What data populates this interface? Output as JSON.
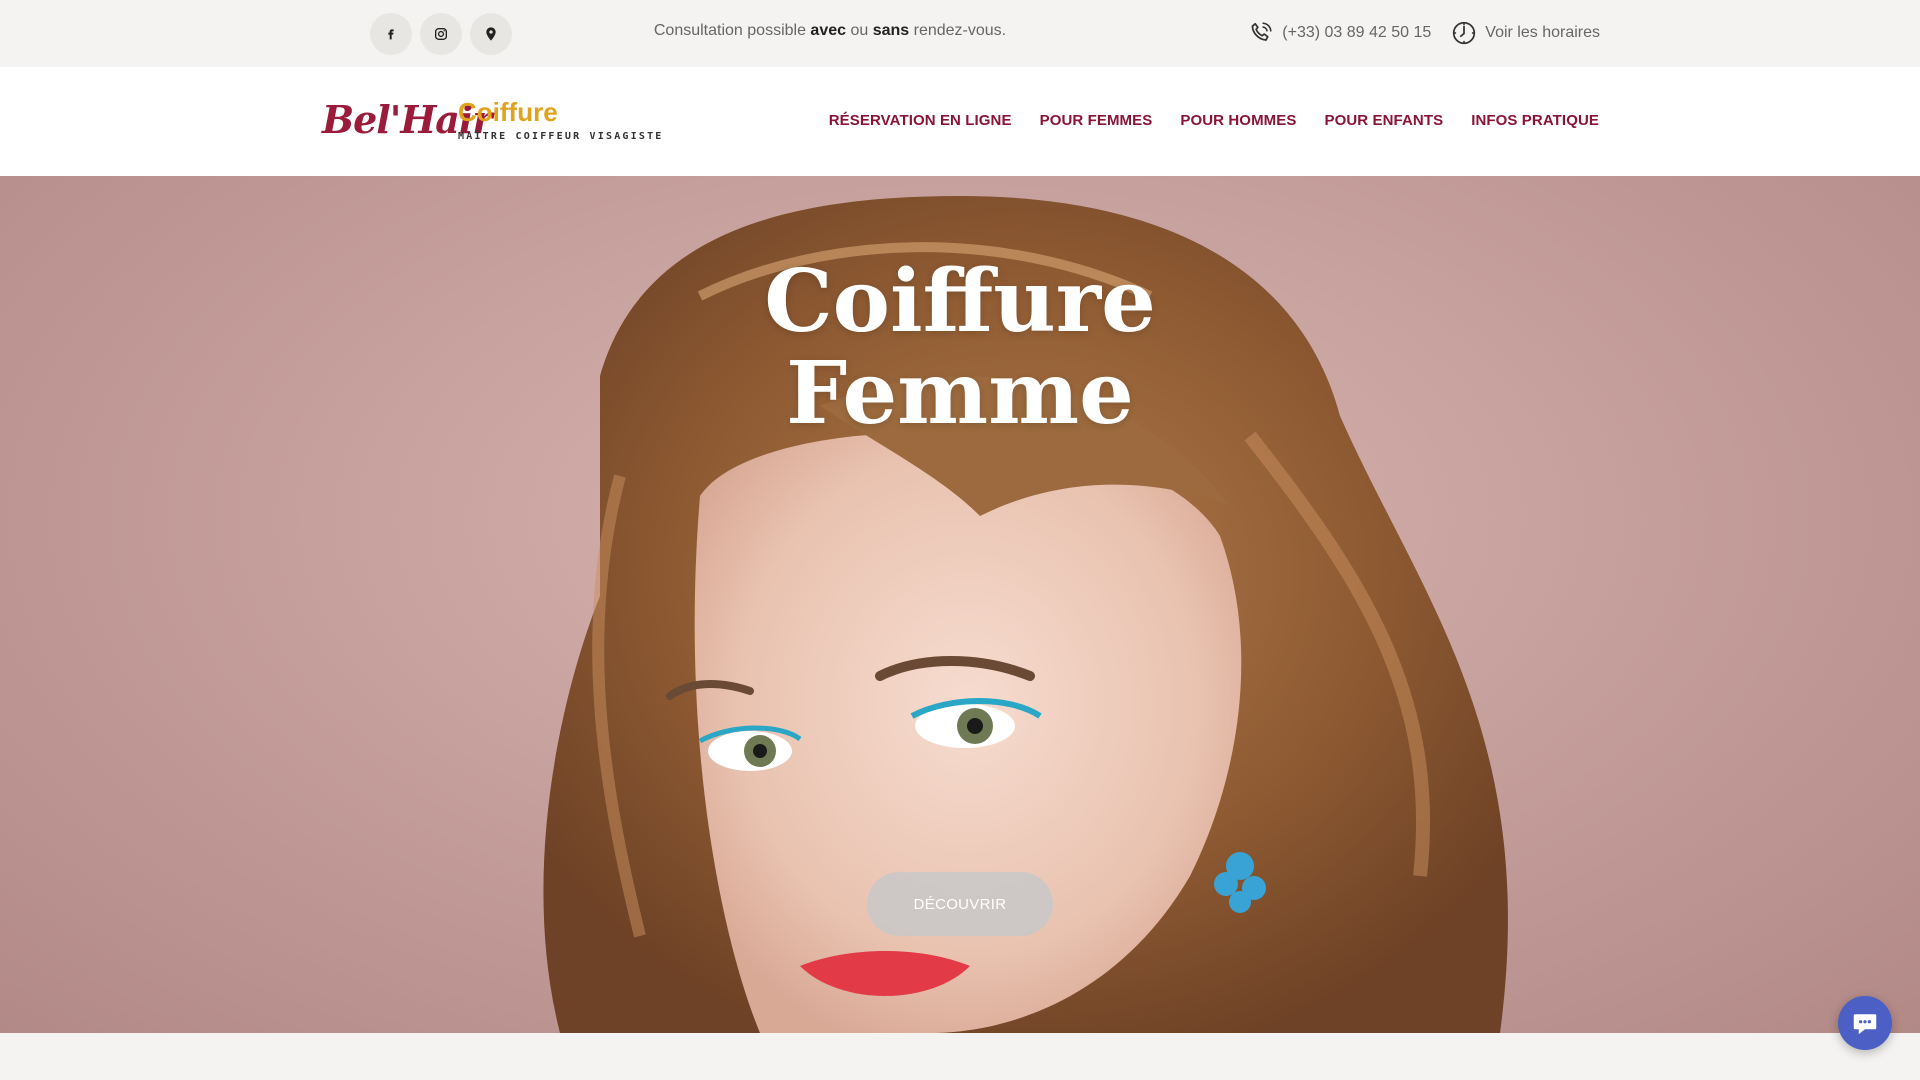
{
  "topbar": {
    "socials": [
      {
        "icon": "facebook-icon"
      },
      {
        "icon": "instagram-icon"
      },
      {
        "icon": "map-pin-icon"
      }
    ],
    "consult": {
      "prefix": "Consultation possible ",
      "avec": "avec",
      "middle": " ou ",
      "sans": "sans",
      "suffix": " rendez-vous."
    },
    "phone": "(+33) 03 89 42 50 15",
    "hours_link": "Voir les horaires"
  },
  "header": {
    "logo": {
      "script": "Bel'Hair",
      "word": "Coiffure",
      "tagline": "MAÎTRE COIFFEUR VISAGISTE"
    },
    "nav": [
      {
        "label": "RÉSERVATION EN LIGNE"
      },
      {
        "label": "POUR FEMMES"
      },
      {
        "label": "POUR HOMMES"
      },
      {
        "label": "POUR ENFANTS"
      },
      {
        "label": "INFOS PRATIQUE"
      }
    ]
  },
  "hero": {
    "title_line1": "Coiffure",
    "title_line2": "Femme",
    "cta_label": "DÉCOUVRIR"
  },
  "colors": {
    "nav": "#8a1436",
    "logo_script": "#9b1b3a",
    "logo_word": "#e0a41c",
    "chat": "#4b5fc4"
  }
}
